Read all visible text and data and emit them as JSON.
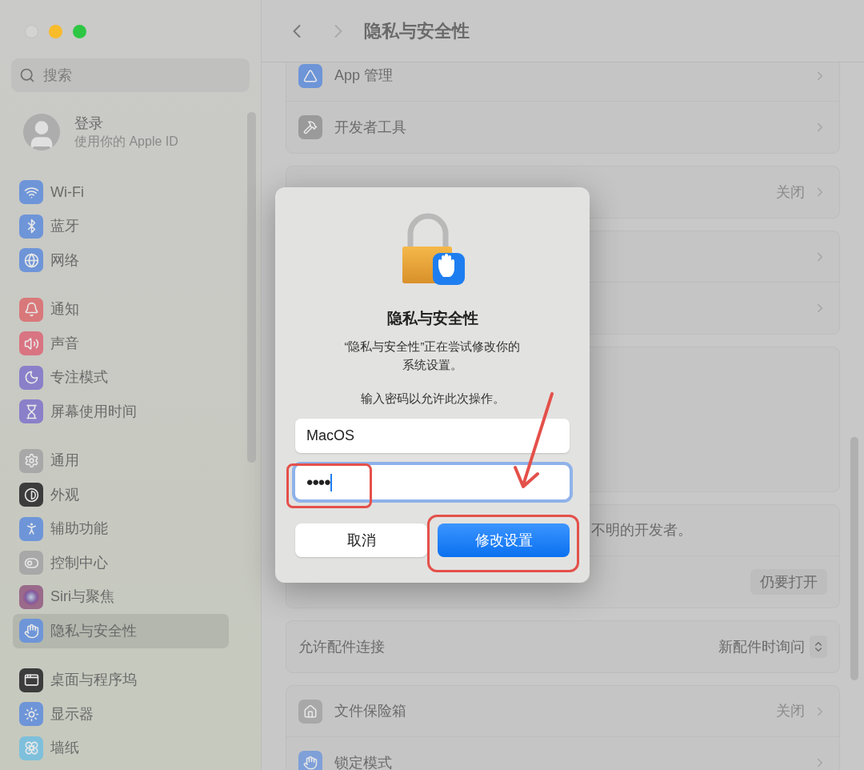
{
  "window": {
    "title": "隐私与安全性"
  },
  "sidebar": {
    "search": {
      "placeholder": "搜索"
    },
    "account": {
      "title": "登录",
      "subtitle": "使用你的 Apple ID"
    },
    "groups": [
      [
        {
          "label": "Wi-Fi",
          "color": "#6e95d8",
          "selected": false
        },
        {
          "label": "蓝牙",
          "color": "#6e95d8",
          "selected": false
        },
        {
          "label": "网络",
          "color": "#6e95d8",
          "selected": false
        }
      ],
      [
        {
          "label": "通知",
          "color": "#d9787a",
          "selected": false
        },
        {
          "label": "声音",
          "color": "#d97482",
          "selected": false
        },
        {
          "label": "专注模式",
          "color": "#8a7fc9",
          "selected": false
        },
        {
          "label": "屏幕使用时间",
          "color": "#8a7fc9",
          "selected": false
        }
      ],
      [
        {
          "label": "通用",
          "color": "#a8a8a8",
          "selected": false
        },
        {
          "label": "外观",
          "color": "#3c3c3c",
          "selected": false
        },
        {
          "label": "辅助功能",
          "color": "#6e95d8",
          "selected": false
        },
        {
          "label": "控制中心",
          "color": "#a8a8a8",
          "selected": false
        },
        {
          "label": "Siri与聚焦",
          "color": "#9a6a8a",
          "selected": false
        },
        {
          "label": "隐私与安全性",
          "color": "#6e95d8",
          "selected": true
        }
      ],
      [
        {
          "label": "桌面与程序坞",
          "color": "#3c3c3c",
          "selected": false
        },
        {
          "label": "显示器",
          "color": "#6e95d8",
          "selected": false
        },
        {
          "label": "墙纸",
          "color": "#7ec0dc",
          "selected": false
        }
      ]
    ]
  },
  "sections": [
    {
      "rows": [
        {
          "kind": "link",
          "label": "App 管理"
        },
        {
          "kind": "link",
          "label": "开发者工具"
        }
      ]
    },
    {
      "rows": [
        {
          "kind": "link",
          "value": "关闭"
        }
      ]
    },
    {
      "rows": [
        {
          "kind": "link"
        },
        {
          "kind": "link"
        }
      ]
    },
    {
      "kind": "blank"
    },
    {
      "rows": [
        {
          "kind": "text",
          "label": "不明的开发者。"
        },
        {
          "kind": "button",
          "value": "仍要打开"
        }
      ]
    },
    {
      "rows": [
        {
          "kind": "select",
          "label": "允许配件连接",
          "value": "新配件时询问"
        }
      ]
    },
    {
      "rows": [
        {
          "kind": "link",
          "label": "文件保险箱",
          "value": "关闭"
        },
        {
          "kind": "link",
          "label": "锁定模式"
        }
      ]
    }
  ],
  "dialog": {
    "title": "隐私与安全性",
    "message_lines": [
      "“隐私与安全性”正在尝试修改你的",
      "系统设置。"
    ],
    "prompt": "输入密码以允许此次操作。",
    "username": {
      "value": "MacOS",
      "focused": false
    },
    "password": {
      "value": "••••",
      "focused": true
    },
    "buttons": [
      {
        "label": "取消",
        "kind": "default"
      },
      {
        "label": "修改设置",
        "kind": "primary"
      }
    ]
  }
}
